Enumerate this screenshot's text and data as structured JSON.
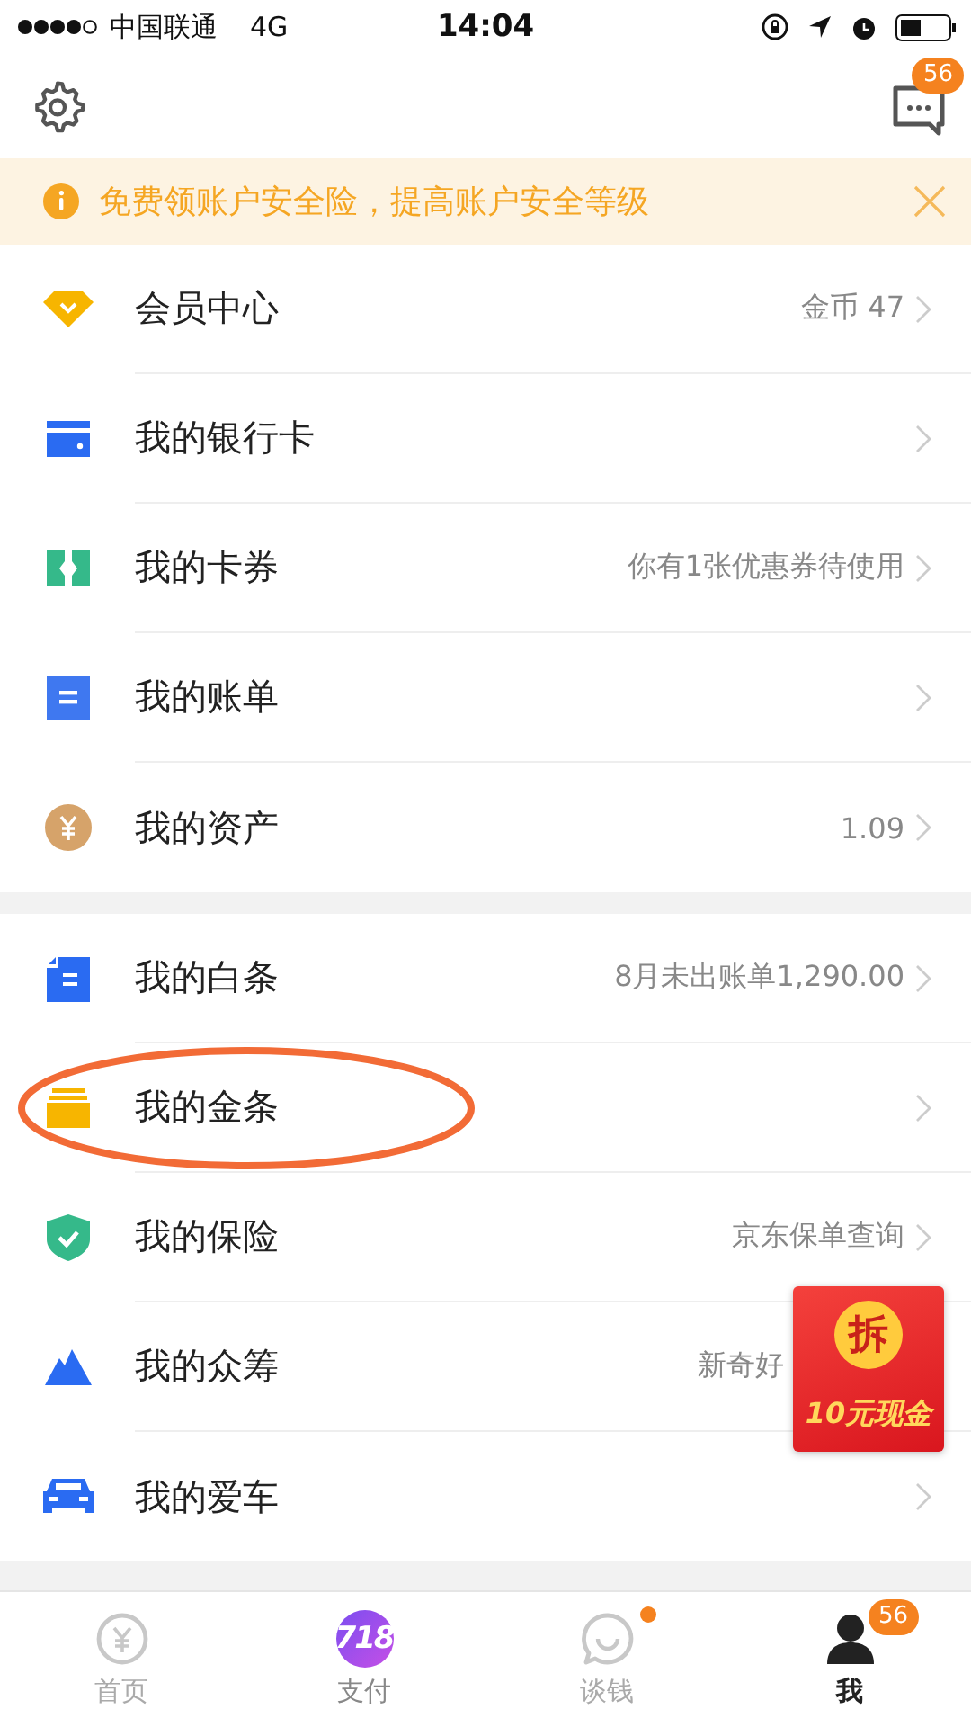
{
  "status_bar": {
    "carrier": "中国联通",
    "network": "4G",
    "time": "14:04"
  },
  "header": {
    "message_badge": "56"
  },
  "notice": {
    "text": "免费领账户安全险，提高账户安全等级"
  },
  "sections": [
    [
      {
        "kind": "diamond",
        "label": "会员中心",
        "value": "金币 47",
        "circled": false
      },
      {
        "kind": "card",
        "label": "我的银行卡",
        "circled": false
      },
      {
        "kind": "ticket",
        "label": "我的卡券",
        "value": "你有1张优惠券待使用",
        "circled": false
      },
      {
        "kind": "bill",
        "label": "我的账单",
        "circled": false
      },
      {
        "kind": "coin",
        "label": "我的资产",
        "value": "1.09",
        "circled": false
      }
    ],
    [
      {
        "kind": "note",
        "label": "我的白条",
        "value": "8月未出账单1,290.00",
        "circled": false
      },
      {
        "kind": "stack",
        "label": "我的金条",
        "circled": true
      },
      {
        "kind": "shield",
        "label": "我的保险",
        "value": "京东保单查询",
        "circled": false
      },
      {
        "kind": "mountain",
        "label": "我的众筹",
        "value": "新奇好",
        "circled": false
      },
      {
        "kind": "car",
        "label": "我的爱车",
        "circled": false
      }
    ]
  ],
  "promo": {
    "badge": "拆",
    "text": "10元现金"
  },
  "tab_bar": [
    {
      "kind": "yuan",
      "label": "首页",
      "selected": false
    },
    {
      "kind": "logo",
      "logo": "718",
      "label": "支付",
      "selected": false
    },
    {
      "kind": "chat",
      "label": "谈钱",
      "selected": false,
      "dot": true
    },
    {
      "kind": "person",
      "label": "我",
      "selected": true,
      "badge": "56"
    }
  ]
}
